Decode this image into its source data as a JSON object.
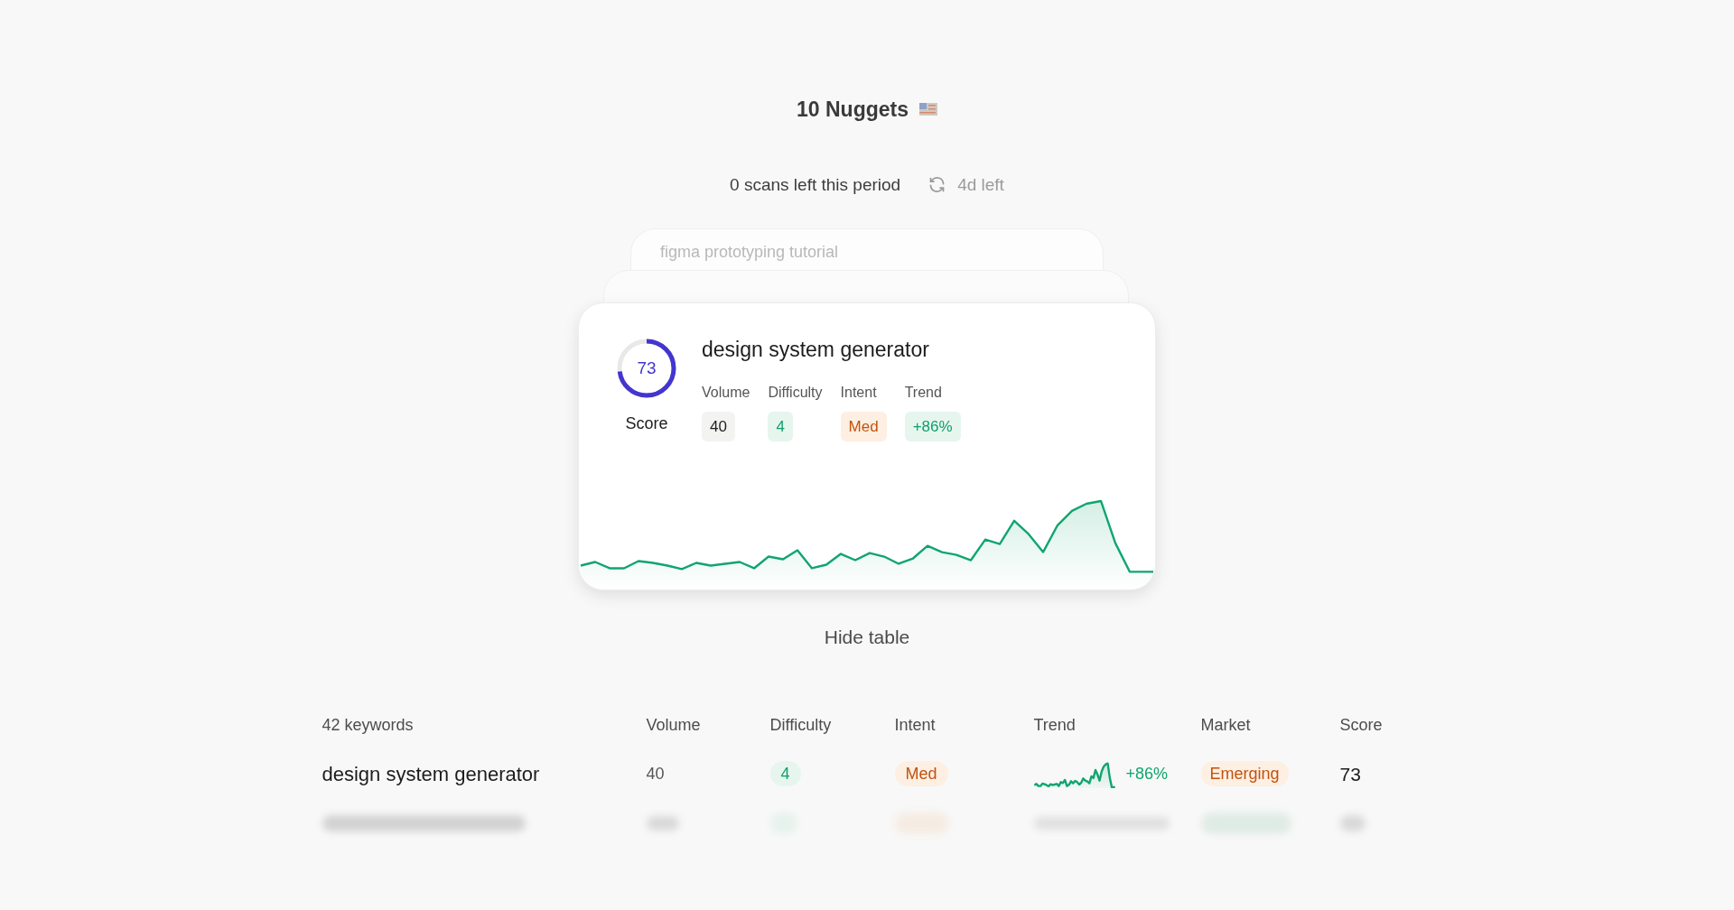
{
  "header": {
    "title": "10 Nuggets",
    "quota": "0 scans left this period",
    "reset": "4d left"
  },
  "stack_cards": [
    {
      "keyword": "figma prototyping tutorial"
    }
  ],
  "card": {
    "keyword": "design system generator",
    "score": {
      "value": "73",
      "label": "Score",
      "level": 0.73
    },
    "metrics": [
      {
        "label": "Volume",
        "value": "40",
        "kind": "plain"
      },
      {
        "label": "Difficulty",
        "value": "4",
        "kind": "green"
      },
      {
        "label": "Intent",
        "value": "Med",
        "kind": "orange"
      },
      {
        "label": "Trend",
        "value": "+86%",
        "kind": "green"
      }
    ]
  },
  "toggle": "Hide table",
  "table": {
    "columns": [
      "42 keywords",
      "Volume",
      "Difficulty",
      "Intent",
      "Trend",
      "Market",
      "Score"
    ],
    "rows": [
      {
        "keyword": "design system generator",
        "volume": "40",
        "difficulty": "4",
        "intent": "Med",
        "trend": "+86%",
        "market": "Emerging",
        "score": "73"
      }
    ]
  }
}
